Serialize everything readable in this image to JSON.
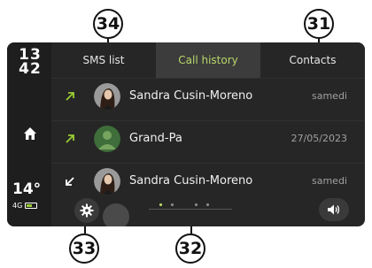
{
  "callouts": {
    "sms": "34",
    "contacts": "31",
    "settings": "33",
    "list": "32"
  },
  "status": {
    "time_hours": "13",
    "time_minutes": "42",
    "temperature": "14°",
    "network": "4G"
  },
  "tabs": [
    {
      "label": "SMS list",
      "active": false
    },
    {
      "label": "Call history",
      "active": true
    },
    {
      "label": "Contacts",
      "active": false
    }
  ],
  "calls": [
    {
      "direction": "outgoing",
      "contact": "Sandra Cusin-Moreno",
      "date": "samedi",
      "avatar": "photo"
    },
    {
      "direction": "outgoing",
      "contact": "Grand-Pa",
      "date": "27/05/2023",
      "avatar": "placeholder"
    },
    {
      "direction": "incoming",
      "contact": "Sandra Cusin-Moreno",
      "date": "samedi",
      "avatar": "photo"
    }
  ],
  "colors": {
    "accent": "#b9d76a",
    "screen_bg": "#262626",
    "active_tab_bg": "#3c3c3c"
  },
  "icons": {
    "home": "home-icon",
    "settings": "gear-icon",
    "volume": "speaker-icon",
    "battery": "battery-icon"
  }
}
